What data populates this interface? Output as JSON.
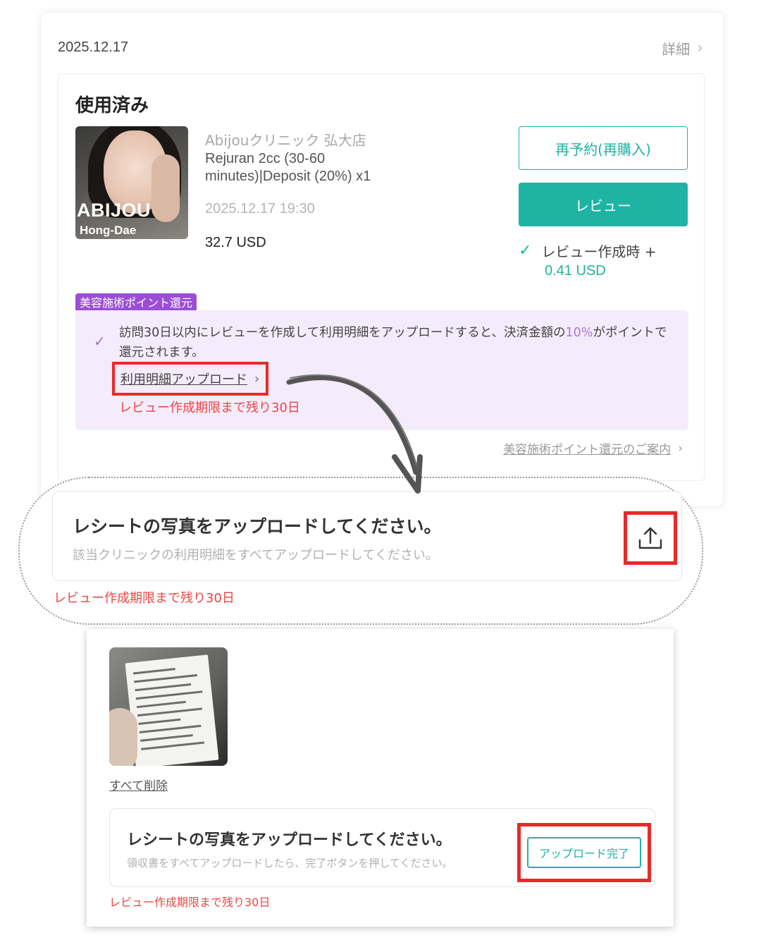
{
  "order": {
    "date": "2025.12.17",
    "detail_label": "詳細",
    "status": "使用済み",
    "thumbnail": {
      "brand": "ABIJOU",
      "sub": "Hong-Dae"
    },
    "clinic": "Abijouクリニック 弘大店",
    "product": "Rejuran 2cc (30-60 minutes)|Deposit (20%) x1",
    "datetime": "2025.12.17 19:30",
    "price": "32.7 USD",
    "rebook_label": "再予約(再購入)",
    "review_label": "レビュー",
    "reward_text": "レビュー作成時 +",
    "reward_amount": "0.41 USD"
  },
  "points_panel": {
    "badge": "美容施術ポイント還元",
    "text_before": "訪問30日以内にレビューを作成して利用明細をアップロードすると、決済金額の",
    "highlight": "10%",
    "text_after": "がポイントで還元されます。",
    "upload_link": "利用明細アップロード",
    "deadline": "レビュー作成期限まで残り30日",
    "guide_link": "美容施術ポイント還元のご案内"
  },
  "upload_prompt": {
    "title": "レシートの写真をアップロードしてください。",
    "subtitle": "該当クリニックの利用明細をすべてアップロードしてください。",
    "deadline": "レビュー作成期限まで残り30日"
  },
  "uploaded": {
    "delete_all": "すべて削除",
    "title": "レシートの写真をアップロードしてください。",
    "subtitle": "領収書をすべてアップロードしたら、完了ボタンを押してください。",
    "complete_label": "アップロード完了",
    "deadline": "レビュー作成期限まで残り30日"
  },
  "icons": {
    "chevron": "chevron-right-icon",
    "check": "check-icon",
    "upload": "upload-icon",
    "arrow": "curved-arrow-icon"
  },
  "colors": {
    "accent": "#1fb3a4",
    "highlight_border": "#e82a2a",
    "deadline": "#f04545",
    "badge": "#9b4dd6",
    "panel": "#f4ecfb"
  }
}
